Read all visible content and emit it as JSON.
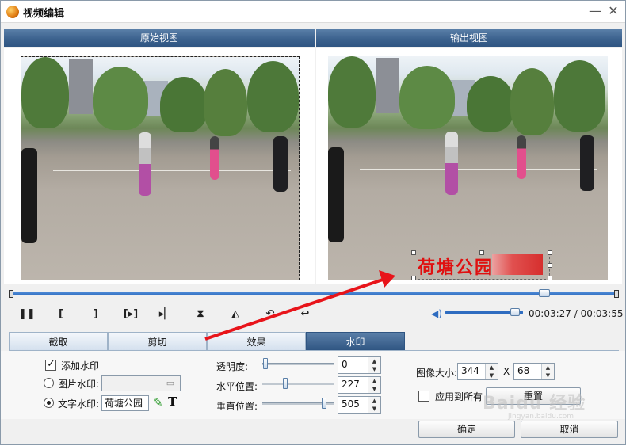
{
  "window": {
    "title": "视频编辑",
    "minimize_label": "—",
    "close_label": "✕"
  },
  "views": {
    "original_label": "原始视图",
    "output_label": "输出视图"
  },
  "watermark_preview_text": "荷塘公园",
  "playback": {
    "time": "00:03:27 / 00:03:55",
    "progress_fraction": 0.88,
    "volume_fraction": 0.9,
    "controls": [
      "pause",
      "mark-in",
      "mark-out",
      "play-segment",
      "next",
      "flip",
      "rotate",
      "undo",
      "reset"
    ]
  },
  "tabs": [
    {
      "label": "截取",
      "active": false
    },
    {
      "label": "剪切",
      "active": false
    },
    {
      "label": "效果",
      "active": false
    },
    {
      "label": "水印",
      "active": true
    }
  ],
  "watermark": {
    "add_watermark_label": "添加水印",
    "add_watermark_checked": true,
    "image_watermark_label": "图片水印:",
    "text_watermark_label": "文字水印:",
    "text_watermark_value": "荷塘公园",
    "selected_mode": "text",
    "opacity_label": "透明度:",
    "opacity_value": "0",
    "hpos_label": "水平位置:",
    "hpos_value": "227",
    "vpos_label": "垂直位置:",
    "vpos_value": "505",
    "image_size_label": "图像大小:",
    "width_value": "344",
    "size_sep": "X",
    "height_value": "68",
    "apply_all_label": "应用到所有",
    "apply_all_checked": false,
    "reset_label": "重置"
  },
  "footer": {
    "ok_label": "确定",
    "cancel_label": "取消"
  },
  "overlay": {
    "baidu_text": "Baidu 经验",
    "baidu_sub": "jingyan.baidu.com",
    "arrow_color": "#e8141a"
  }
}
